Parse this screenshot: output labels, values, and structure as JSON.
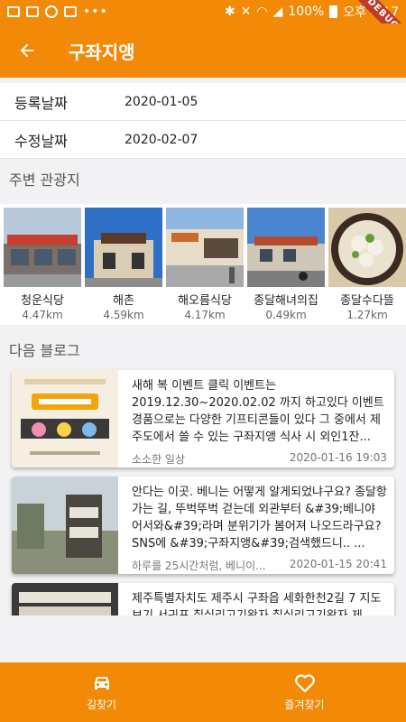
{
  "status_bar": {
    "battery": "100%",
    "time": "오후 4:17",
    "debug_banner": "DEBUG"
  },
  "app_bar": {
    "title": "구좌지앵",
    "back_icon": "arrow-left-icon"
  },
  "info": {
    "registered_label": "등록날짜",
    "registered_value": "2020-01-05",
    "modified_label": "수정날짜",
    "modified_value": "2020-02-07"
  },
  "nearby": {
    "section_title": "주변 관광지",
    "items": [
      {
        "name": "청운식당",
        "distance": "4.47km"
      },
      {
        "name": "해촌",
        "distance": "4.59km"
      },
      {
        "name": "해오름식당",
        "distance": "4.17km"
      },
      {
        "name": "종달해녀의집",
        "distance": "0.49km"
      },
      {
        "name": "종달수다뜰",
        "distance": "1.27km"
      }
    ]
  },
  "blogs": {
    "section_title": "다음 블로그",
    "items": [
      {
        "text": "새해 복 이벤트 클릭   이벤트는 2019.12.30~2020.02.02 까지 하고있다  이벤트 경품으로는 다양한 기프티콘들이 있다  그 중에서 제주도에서 쓸 수 있는 구좌지앵 식사 시 외인1잔...",
        "source": "소소한 일상",
        "date": "2020-01-16 19:03"
      },
      {
        "text": "안다는 이곳. 베니는 어떻게 알게되었냐구요? 종달항 가는 길, 뚜벅뚜벅 걷는데 외관부터 &#39;베니야 어서와&#39;라며 분위기가 봄어져 나오드라구요? SNS에 &#39;구좌지앵&#39;검색했드니.. ...",
        "source": "하루를 25시간처럼, 베니이...",
        "date": "2020-01-15 20:41"
      },
      {
        "text": "제주특별자치도 제주시 구좌읍 세화한천2길 7 지도보기 서귀포 칠십리고기왕자 칠십리고기왕자 제",
        "source": "",
        "date": ""
      }
    ]
  },
  "bottom_nav": {
    "directions_label": "길찾기",
    "favorite_label": "즐겨찾기"
  },
  "colors": {
    "accent": "#f28a08"
  }
}
